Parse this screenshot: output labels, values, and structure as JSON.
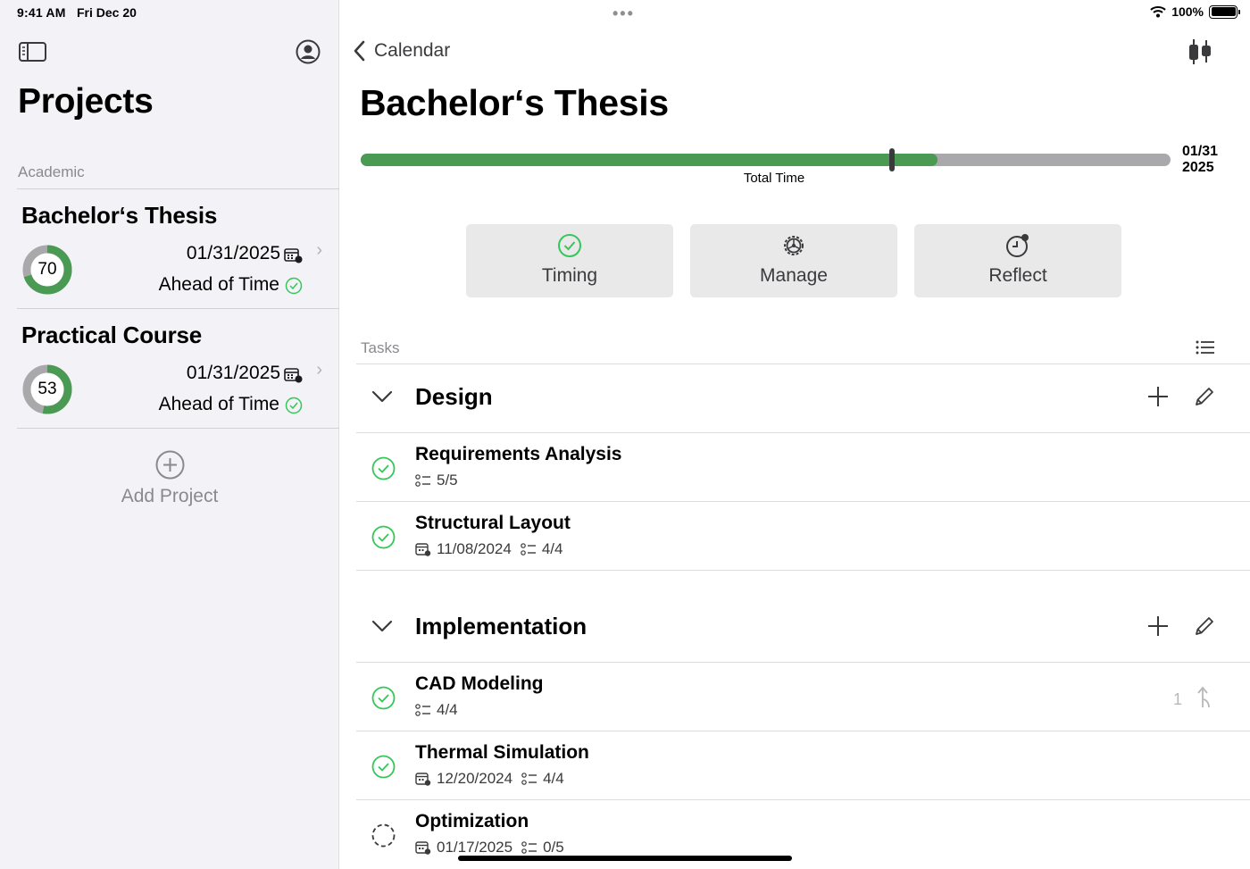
{
  "status_bar": {
    "time": "9:41 AM",
    "date": "Fri Dec 20",
    "battery": "100%"
  },
  "sidebar": {
    "title": "Projects",
    "section": "Academic",
    "projects": [
      {
        "name": "Bachelor‘s Thesis",
        "progress": 70,
        "date": "01/31/2025",
        "status": "Ahead of Time"
      },
      {
        "name": "Practical Course",
        "progress": 53,
        "date": "01/31/2025",
        "status": "Ahead of Time"
      }
    ],
    "add_project_label": "Add Project"
  },
  "main": {
    "back_label": "Calendar",
    "title": "Bachelor‘s Thesis",
    "progress": {
      "label": "Total Time",
      "fill_fraction": 0.712,
      "marker_fraction": 0.656,
      "deadline_md": "01/31",
      "deadline_year": "2025"
    },
    "actions": [
      {
        "label": "Timing",
        "icon": "checkmark-circle-icon"
      },
      {
        "label": "Manage",
        "icon": "gear-icon"
      },
      {
        "label": "Reflect",
        "icon": "clock-badge-icon"
      }
    ],
    "tasks_label": "Tasks",
    "groups": [
      {
        "name": "Design",
        "tasks": [
          {
            "name": "Requirements Analysis",
            "date": "",
            "subtasks": "5/5",
            "done": true
          },
          {
            "name": "Structural Layout",
            "date": "11/08/2024",
            "subtasks": "4/4",
            "done": true
          }
        ]
      },
      {
        "name": "Implementation",
        "tasks": [
          {
            "name": "CAD Modeling",
            "date": "",
            "subtasks": "4/4",
            "done": true,
            "dependency_count": "1"
          },
          {
            "name": "Thermal Simulation",
            "date": "12/20/2024",
            "subtasks": "4/4",
            "done": true
          },
          {
            "name": "Optimization",
            "date": "01/17/2025",
            "subtasks": "0/5",
            "done": false
          }
        ]
      }
    ]
  },
  "colors": {
    "accent_green": "#4a9a54",
    "check_green": "#34c759",
    "track_gray": "#a9a9ab",
    "sidebar_bg": "#f2f2f7"
  }
}
